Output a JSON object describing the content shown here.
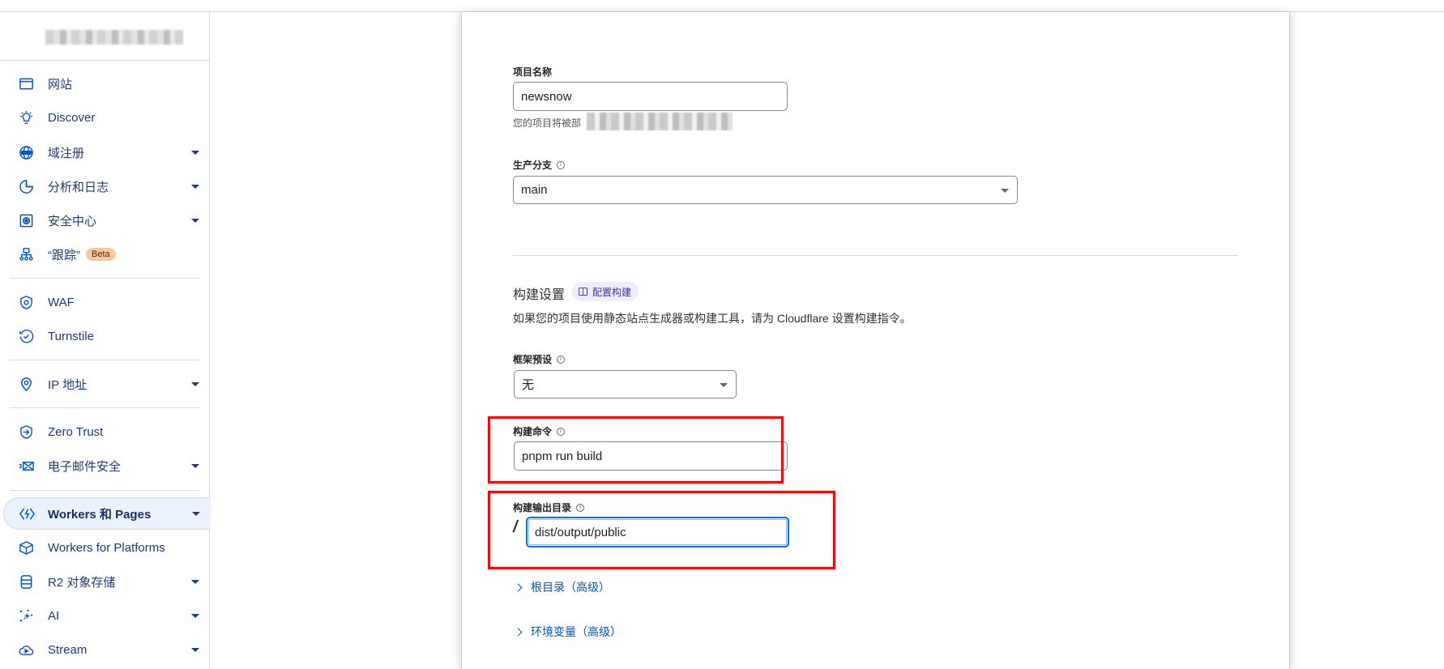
{
  "sidebar": {
    "account_name": "",
    "items": [
      {
        "label": "网站",
        "icon": "browser-window-icon",
        "caret": false
      },
      {
        "label": "Discover",
        "icon": "lightbulb-icon",
        "caret": false
      },
      {
        "label": "域注册",
        "icon": "globe-icon",
        "caret": true
      },
      {
        "label": "分析和日志",
        "icon": "pie-chart-icon",
        "caret": true
      },
      {
        "label": "安全中心",
        "icon": "vault-icon",
        "caret": true
      },
      {
        "label": "“跟踪”",
        "icon": "sitemap-icon",
        "caret": false,
        "badge": "Beta"
      },
      {
        "label": "WAF",
        "icon": "shield-gear-icon",
        "caret": false
      },
      {
        "label": "Turnstile",
        "icon": "turnstile-check-icon",
        "caret": false
      },
      {
        "label": "IP 地址",
        "icon": "location-pin-icon",
        "caret": true
      },
      {
        "label": "Zero Trust",
        "icon": "shield-arrow-icon",
        "caret": false
      },
      {
        "label": "电子邮件安全",
        "icon": "mail-icon",
        "caret": true
      },
      {
        "label": "Workers 和 Pages",
        "icon": "workers-icon",
        "caret": true,
        "active": true
      },
      {
        "label": "Workers for Platforms",
        "icon": "cube-icon",
        "caret": false
      },
      {
        "label": "R2 对象存储",
        "icon": "database-icon",
        "caret": true
      },
      {
        "label": "AI",
        "icon": "sparkles-icon",
        "caret": true
      },
      {
        "label": "Stream",
        "icon": "cloud-play-icon",
        "caret": true
      }
    ]
  },
  "form": {
    "project_name": {
      "label": "项目名称",
      "value": "newsnow",
      "hint": "您的项目将被部"
    },
    "production_branch": {
      "label": "生产分支",
      "value": "main"
    },
    "build_settings": {
      "title": "构建设置",
      "configure_link": "配置构建",
      "description": "如果您的项目使用静态站点生成器或构建工具，请为 Cloudflare 设置构建指令。"
    },
    "framework_preset": {
      "label": "框架预设",
      "value": "无"
    },
    "build_command": {
      "label": "构建命令",
      "value": "pnpm run build"
    },
    "build_output_dir": {
      "label": "构建输出目录",
      "prefix": "/",
      "value": "dist/output/public"
    },
    "root_dir_link": "根目录（高级）",
    "env_vars_link": "环境变量（高级）"
  },
  "colors": {
    "accent": "#0a55c6",
    "highlight_box": "#ff0000",
    "focus": "#0a6cf5",
    "beta_badge": "#f9c99e"
  }
}
